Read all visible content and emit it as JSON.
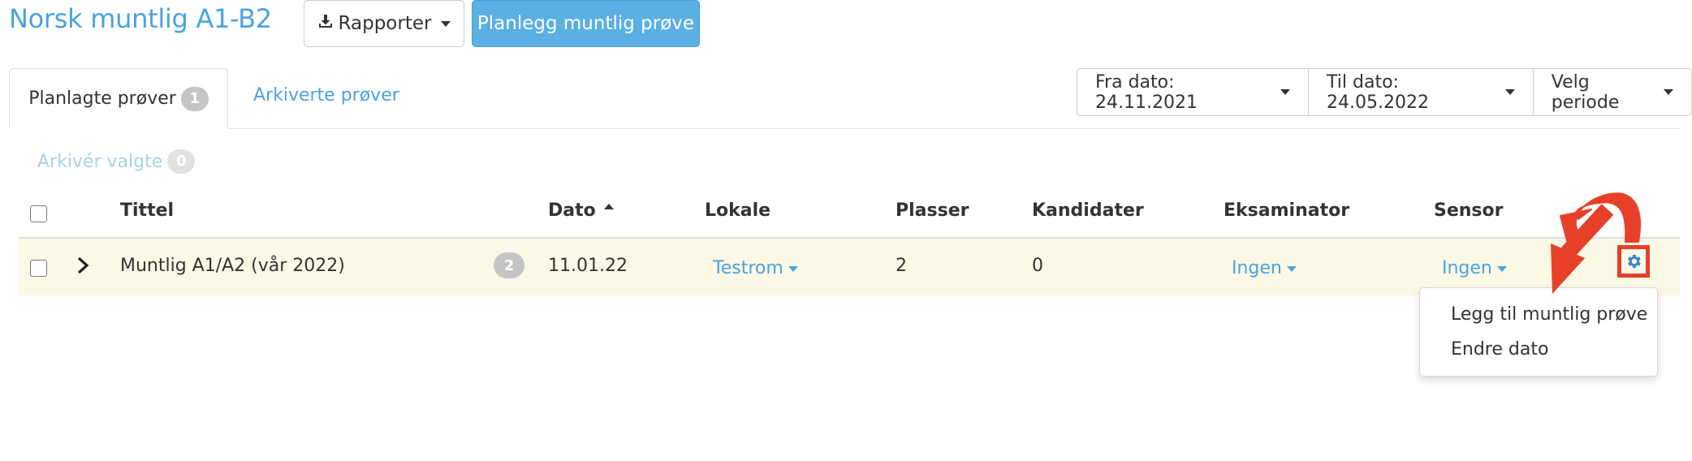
{
  "header": {
    "title": "Norsk muntlig A1-B2",
    "reports_label": "Rapporter",
    "plan_label": "Planlegg muntlig prøve"
  },
  "tabs": [
    {
      "label": "Planlagte prøver",
      "count": "1",
      "active": true
    },
    {
      "label": "Arkiverte prøver",
      "active": false
    }
  ],
  "date_filters": {
    "from_label": "Fra dato: 24.11.2021",
    "to_label": "Til dato: 24.05.2022",
    "period_label": "Velg periode"
  },
  "archive": {
    "label": "Arkivér valgte",
    "count": "0"
  },
  "table": {
    "columns": [
      "Tittel",
      "Dato",
      "Lokale",
      "Plasser",
      "Kandidater",
      "Eksaminator",
      "Sensor"
    ],
    "rows": [
      {
        "title": "Muntlig A1/A2 (vår 2022)",
        "count": "2",
        "date": "11.01.22",
        "location": "Testrom",
        "seats": "2",
        "candidates": "0",
        "examiner": "Ingen",
        "sensor": "Ingen"
      }
    ]
  },
  "context_menu": {
    "items": [
      "Legg til muntlig prøve",
      "Endre dato"
    ]
  },
  "colors": {
    "accent": "#4aa3df",
    "primary_button": "#5aafe3",
    "row_highlight": "#fcf8e6",
    "annotation_arrow": "#e74029"
  },
  "icons": {
    "reports": "download-icon",
    "expand": "chevron-right-icon",
    "settings": "gear-icon"
  }
}
